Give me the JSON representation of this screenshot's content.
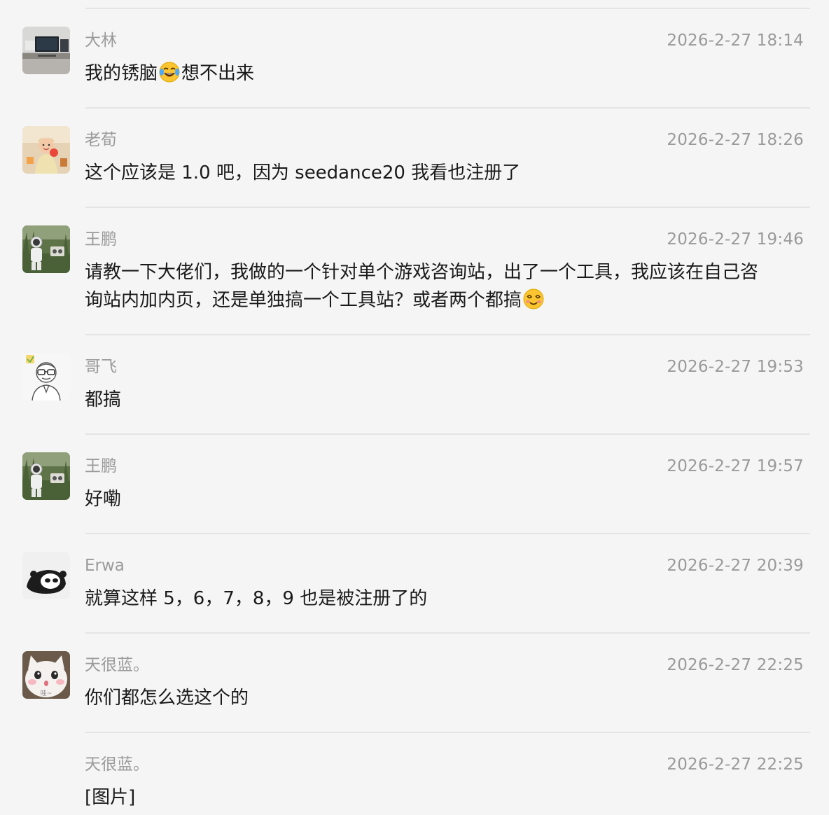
{
  "messages": [
    {
      "sender": "大林",
      "time": "2026-2-27 18:14",
      "text_before": "我的锈脑",
      "emoji": "laughing-tears-emoji",
      "text_after": "想不出来"
    },
    {
      "sender": "老荀",
      "time": "2026-2-27 18:26",
      "text": "这个应该是 1.0 吧，因为 seedance20 我看也注册了"
    },
    {
      "sender": "王鹏",
      "time": "2026-2-27 19:46",
      "text_line1": "请教一下大佬们，我做的一个针对单个游戏咨询站，出了一个工具，我应该在自己咨",
      "text_line2": "询站内加内页，还是单独搞一个工具站？或者两个都搞",
      "emoji": "dizzy-smile-emoji"
    },
    {
      "sender": "哥飞",
      "time": "2026-2-27 19:53",
      "text": "都搞"
    },
    {
      "sender": "王鹏",
      "time": "2026-2-27 19:57",
      "text": "好嘞"
    },
    {
      "sender": "Erwa",
      "time": "2026-2-27 20:39",
      "text": "就算这样 5，6，7，8，9 也是被注册了的"
    },
    {
      "sender": "天很蓝。",
      "time": "2026-2-27 22:25",
      "text": "你们都怎么选这个的"
    },
    {
      "sender": "天很蓝。",
      "time": "2026-2-27 22:25",
      "text": "[图片]"
    }
  ],
  "avatars": {
    "cat_caption": "哇~"
  },
  "colors": {
    "background": "#f5f5f5",
    "divider": "#e4e4e4",
    "meta_text": "#9a9a9a",
    "body_text": "#1a1a1a"
  }
}
